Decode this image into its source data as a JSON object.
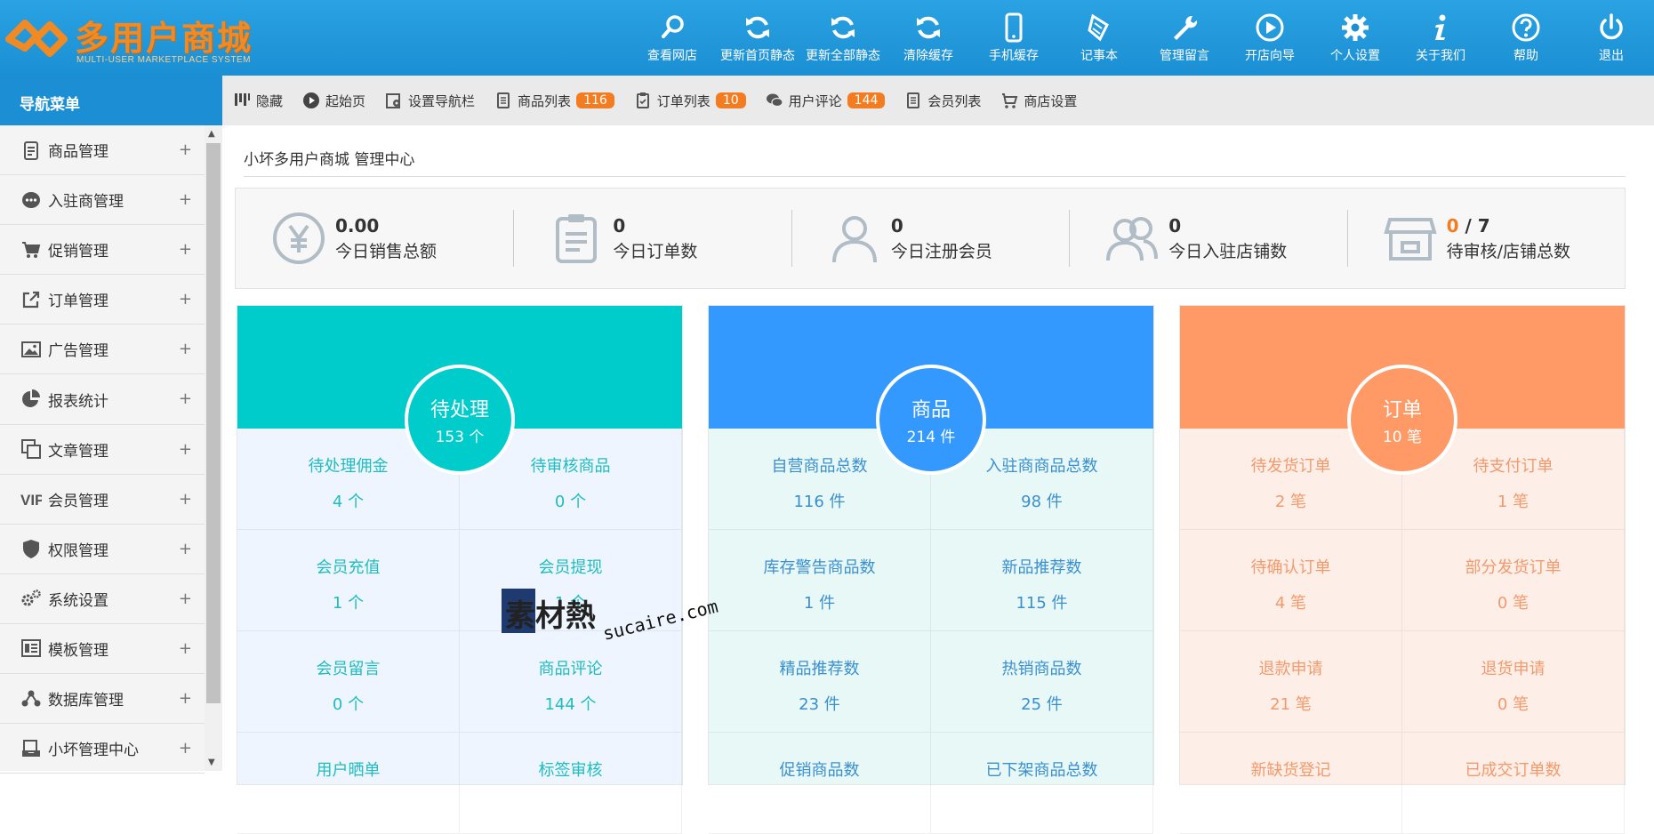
{
  "header": {
    "logo_title": "多用户商城",
    "logo_subtitle": "MULTI-USER MARKETPLACE SYSTEM",
    "nav": [
      {
        "label": "查看网店",
        "icon": "search-icon"
      },
      {
        "label": "更新首页静态",
        "icon": "refresh-icon"
      },
      {
        "label": "更新全部静态",
        "icon": "refresh-icon"
      },
      {
        "label": "清除缓存",
        "icon": "refresh-icon"
      },
      {
        "label": "手机缓存",
        "icon": "mobile-icon"
      },
      {
        "label": "记事本",
        "icon": "notebook-icon"
      },
      {
        "label": "管理留言",
        "icon": "wrench-icon"
      },
      {
        "label": "开店向导",
        "icon": "play-icon"
      },
      {
        "label": "个人设置",
        "icon": "gear-icon"
      },
      {
        "label": "关于我们",
        "icon": "info-icon"
      },
      {
        "label": "帮助",
        "icon": "help-icon"
      },
      {
        "label": "退出",
        "icon": "power-icon"
      }
    ]
  },
  "sidebar": {
    "title": "导航菜单",
    "items": [
      {
        "label": "商品管理",
        "icon": "product-icon"
      },
      {
        "label": "入驻商管理",
        "icon": "chat-icon"
      },
      {
        "label": "促销管理",
        "icon": "cart-icon"
      },
      {
        "label": "订单管理",
        "icon": "external-icon"
      },
      {
        "label": "广告管理",
        "icon": "image-icon"
      },
      {
        "label": "报表统计",
        "icon": "pie-icon"
      },
      {
        "label": "文章管理",
        "icon": "copy-icon"
      },
      {
        "label": "会员管理",
        "icon": "vip-icon"
      },
      {
        "label": "权限管理",
        "icon": "shield-icon"
      },
      {
        "label": "系统设置",
        "icon": "gears-icon"
      },
      {
        "label": "模板管理",
        "icon": "template-icon"
      },
      {
        "label": "数据库管理",
        "icon": "network-icon"
      },
      {
        "label": "小坏管理中心",
        "icon": "inbox-icon"
      }
    ],
    "expand_symbol": "+"
  },
  "toolbar": {
    "items": [
      {
        "label": "隐藏",
        "icon": "bars-icon",
        "badge": null
      },
      {
        "label": "起始页",
        "icon": "play-circle-icon",
        "badge": null
      },
      {
        "label": "设置导航栏",
        "icon": "settings-doc-icon",
        "badge": null
      },
      {
        "label": "商品列表",
        "icon": "list-doc-icon",
        "badge": "116"
      },
      {
        "label": "订单列表",
        "icon": "order-doc-icon",
        "badge": "10"
      },
      {
        "label": "用户评论",
        "icon": "comments-icon",
        "badge": "144"
      },
      {
        "label": "会员列表",
        "icon": "member-doc-icon",
        "badge": null
      },
      {
        "label": "商店设置",
        "icon": "shop-icon",
        "badge": null
      }
    ]
  },
  "main": {
    "breadcrumb": "小坏多用户商城 管理中心",
    "stats": [
      {
        "value": "0.00",
        "caption": "今日销售总额",
        "icon": "yen-icon"
      },
      {
        "value": "0",
        "caption": "今日订单数",
        "icon": "clipboard-icon"
      },
      {
        "value": "0",
        "caption": "今日注册会员",
        "icon": "user-icon"
      },
      {
        "value": "0",
        "caption": "今日入驻店铺数",
        "icon": "users-icon"
      },
      {
        "value_highlight": "0",
        "value_rest": " / 7",
        "caption": "待审核/店铺总数",
        "icon": "store-icon"
      }
    ],
    "panels": [
      {
        "title": "待处理",
        "count": "153 个",
        "colors": {
          "head": "#00cccc",
          "body": "#eef5ff",
          "text": "#1fbcc0"
        },
        "cells": [
          {
            "label": "待处理佣金",
            "value": "4 个"
          },
          {
            "label": "待审核商品",
            "value": "0 个"
          },
          {
            "label": "会员充值",
            "value": "1 个"
          },
          {
            "label": "会员提现",
            "value": "1 个"
          },
          {
            "label": "会员留言",
            "value": "0 个"
          },
          {
            "label": "商品评论",
            "value": "144 个"
          },
          {
            "label": "用户晒单",
            "value": ""
          },
          {
            "label": "标签审核",
            "value": ""
          }
        ]
      },
      {
        "title": "商品",
        "count": "214 件",
        "colors": {
          "head": "#3399ff",
          "body": "#e8f8f6",
          "text": "#3a8fd0"
        },
        "cells": [
          {
            "label": "自营商品总数",
            "value": "116 件"
          },
          {
            "label": "入驻商商品总数",
            "value": "98 件"
          },
          {
            "label": "库存警告商品数",
            "value": "1 件"
          },
          {
            "label": "新品推荐数",
            "value": "115 件"
          },
          {
            "label": "精品推荐数",
            "value": "23 件"
          },
          {
            "label": "热销商品数",
            "value": "25 件"
          },
          {
            "label": "促销商品数",
            "value": ""
          },
          {
            "label": "已下架商品总数",
            "value": ""
          }
        ]
      },
      {
        "title": "订单",
        "count": "10 笔",
        "colors": {
          "head": "#ff9966",
          "body": "#fdeee8",
          "text": "#f29a6c"
        },
        "cells": [
          {
            "label": "待发货订单",
            "value": "2 笔"
          },
          {
            "label": "待支付订单",
            "value": "1 笔"
          },
          {
            "label": "待确认订单",
            "value": "4 笔"
          },
          {
            "label": "部分发货订单",
            "value": "0 笔"
          },
          {
            "label": "退款申请",
            "value": "21 笔"
          },
          {
            "label": "退货申请",
            "value": "0 笔"
          },
          {
            "label": "新缺货登记",
            "value": ""
          },
          {
            "label": "已成交订单数",
            "value": ""
          }
        ]
      }
    ]
  },
  "watermark": {
    "brand": "素材熱",
    "url": "sucaire.com"
  },
  "colors": {
    "topbar": "#1b8fd3",
    "accent": "#f47c20",
    "sidebar_bg": "#f4f4f4"
  }
}
